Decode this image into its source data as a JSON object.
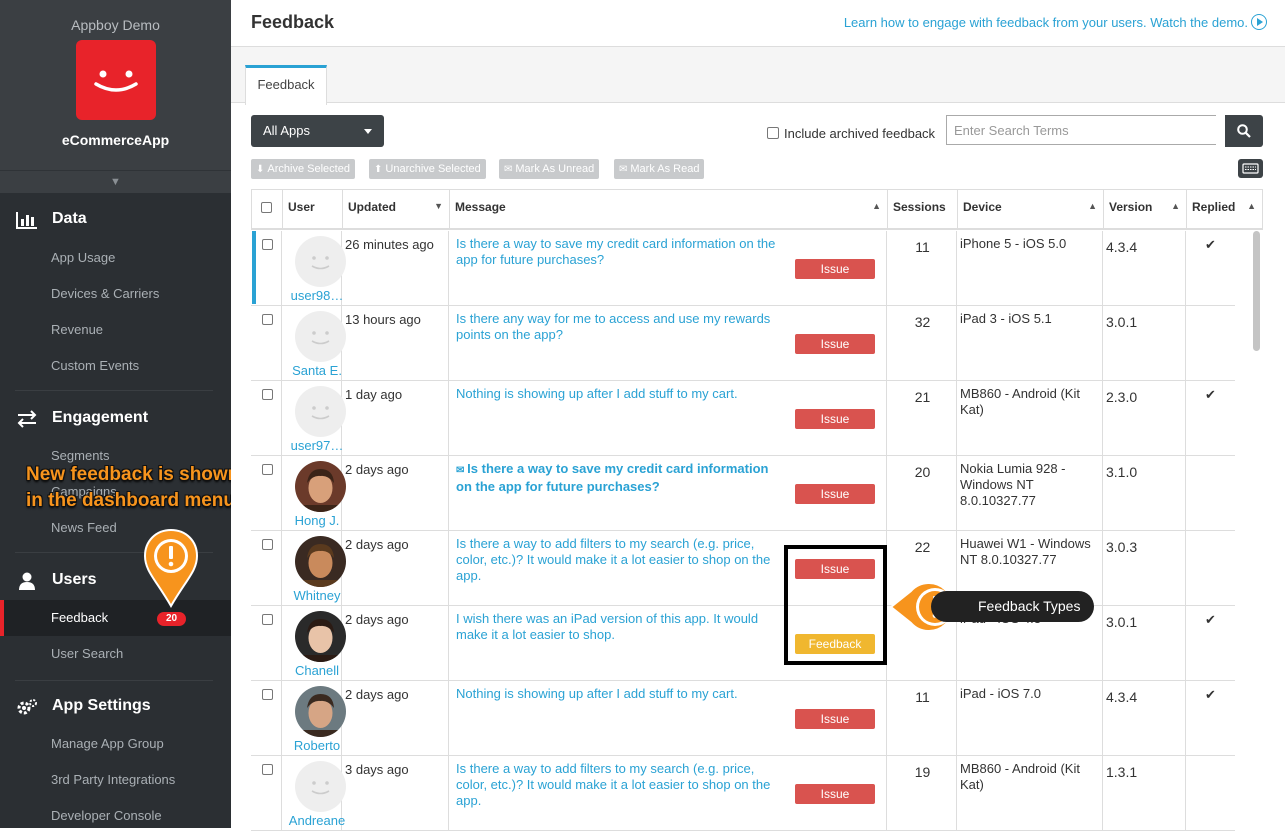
{
  "sidebar": {
    "org": "Appboy Demo",
    "app_name": "eCommerceApp",
    "sections": {
      "data": {
        "title": "Data",
        "items": [
          "App Usage",
          "Devices & Carriers",
          "Revenue",
          "Custom Events"
        ]
      },
      "engagement": {
        "title": "Engagement",
        "items": [
          "Segments",
          "Campaigns",
          "News Feed"
        ]
      },
      "users": {
        "title": "Users",
        "items": [
          "Feedback",
          "User Search"
        ],
        "feedback_badge": "20"
      },
      "settings": {
        "title": "App Settings",
        "items": [
          "Manage App Group",
          "3rd Party Integrations",
          "Developer Console"
        ]
      }
    }
  },
  "annotation": {
    "menu_line1": "New feedback is shown",
    "menu_line2": "in the dashboard menu",
    "types": "Feedback Types"
  },
  "header": {
    "title": "Feedback",
    "demo_link": "Learn how to engage with feedback from your users. Watch the demo."
  },
  "tabs": [
    "Feedback"
  ],
  "toolbar": {
    "apps_select": "All Apps",
    "archived_label": "Include archived feedback",
    "search_placeholder": "Enter Search Terms",
    "actions": [
      "Archive Selected",
      "Unarchive Selected",
      "Mark As Unread",
      "Mark As Read"
    ]
  },
  "table": {
    "columns": [
      "User",
      "Updated",
      "Message",
      "Sessions",
      "Device",
      "Version",
      "Replied"
    ],
    "rows": [
      {
        "user": "user98…",
        "updated": "26 minutes ago",
        "message": "Is there a way to save my credit card information on the app for future purchases?",
        "type": "Issue",
        "sessions": "11",
        "device": "iPhone 5 - iOS 5.0",
        "version": "4.3.4",
        "replied": "✔",
        "unread": false
      },
      {
        "user": "Santa E.",
        "updated": "13 hours ago",
        "message": "Is there any way for me to access and use my rewards points on the app?",
        "type": "Issue",
        "sessions": "32",
        "device": "iPad 3 - iOS 5.1",
        "version": "3.0.1",
        "replied": "",
        "unread": false
      },
      {
        "user": "user97…",
        "updated": "1 day ago",
        "message": "Nothing is showing up after I add stuff to my cart.",
        "type": "Issue",
        "sessions": "21",
        "device": "MB860 - Android (Kit Kat)",
        "version": "2.3.0",
        "replied": "✔",
        "unread": false
      },
      {
        "user": "Hong J.",
        "updated": "2 days ago",
        "message": "Is there a way to save my credit card information on the app for future purchases?",
        "type": "Issue",
        "sessions": "20",
        "device": "Nokia Lumia 928 - Windows NT 8.0.10327.77",
        "version": "3.1.0",
        "replied": "",
        "unread": true
      },
      {
        "user": "Whitney",
        "updated": "2 days ago",
        "message": "Is there a way to add filters to my search (e.g. price, color, etc.)? It would make it a lot easier to shop on the app.",
        "type": "Issue",
        "sessions": "22",
        "device": "Huawei W1 - Windows NT 8.0.10327.77",
        "version": "3.0.3",
        "replied": "",
        "unread": false
      },
      {
        "user": "Chanell",
        "updated": "2 days ago",
        "message": "I wish there was an iPad version of this app. It would make it a lot easier to shop.",
        "type": "Feedback",
        "sessions": "",
        "device": "iPad - iOS 4.3",
        "version": "3.0.1",
        "replied": "✔",
        "unread": false
      },
      {
        "user": "Roberto",
        "updated": "2 days ago",
        "message": "Nothing is showing up after I add stuff to my cart.",
        "type": "Issue",
        "sessions": "11",
        "device": "iPad - iOS 7.0",
        "version": "4.3.4",
        "replied": "✔",
        "unread": false
      },
      {
        "user": "Andreane",
        "updated": "3 days ago",
        "message": "Is there a way to add filters to my search (e.g. price, color, etc.)? It would make it a lot easier to shop on the app.",
        "type": "Issue",
        "sessions": "19",
        "device": "MB860 - Android (Kit Kat)",
        "version": "1.3.1",
        "replied": "",
        "unread": false
      }
    ]
  },
  "colors": {
    "accent": "#2aa2d4",
    "brand_red": "#e8232a",
    "issue": "#d9534f",
    "feedback": "#f0b72f",
    "annotation_orange": "#f7941d"
  }
}
